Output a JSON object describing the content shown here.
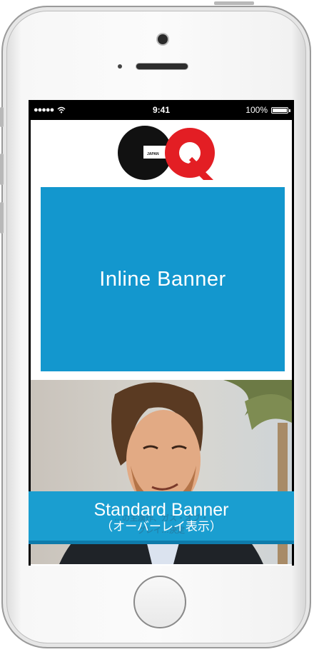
{
  "status_bar": {
    "signal": "●●●●●",
    "time": "9:41",
    "battery": "100%"
  },
  "logo": {
    "text": "GQ",
    "subtext": "JAPAN"
  },
  "inline_banner": {
    "label": "Inline Banner"
  },
  "standard_banner": {
    "title": "Standard Banner",
    "subtitle": "（オーバーレイ表示）",
    "ghost_line1": "…の主演作、ガス・オブ・",
    "ghost_line2": "グレイ…決定"
  },
  "colors": {
    "banner_blue": "#1397ce",
    "gq_red": "#e31e24",
    "gq_black": "#111111"
  }
}
